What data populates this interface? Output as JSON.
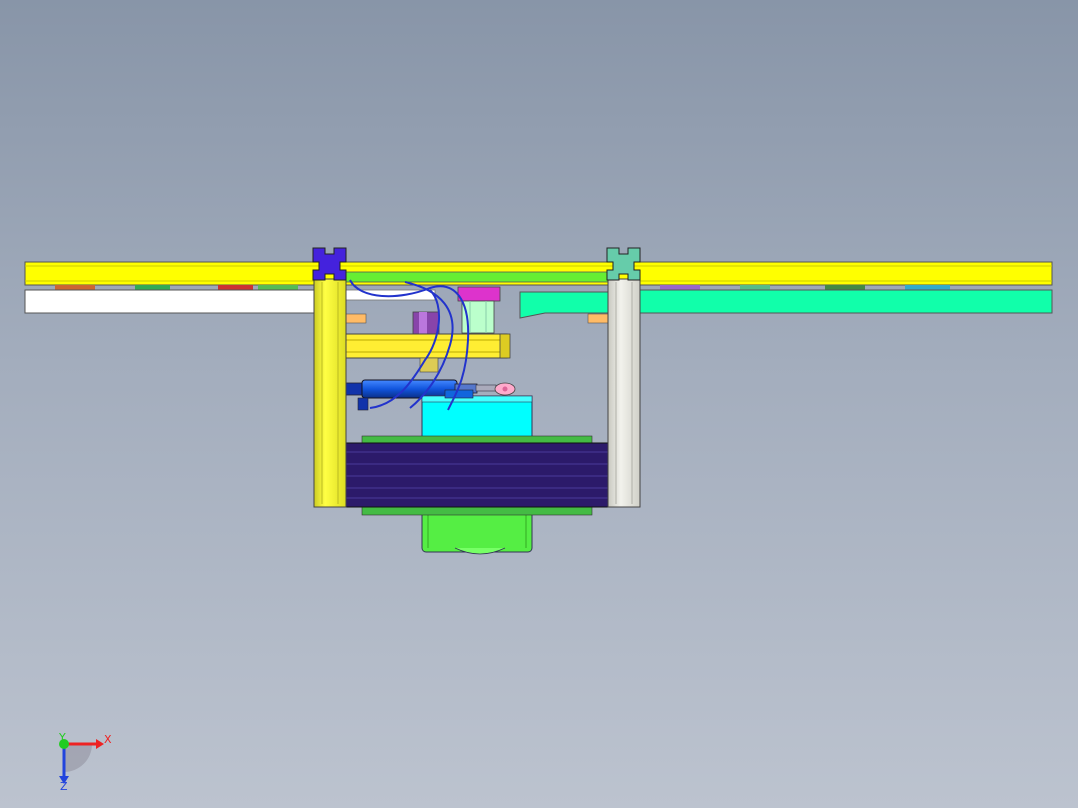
{
  "viewport": {
    "background_top": "#8895a8",
    "background_bottom": "#bcc3cf"
  },
  "colors": {
    "rail_yellow": "#ffff00",
    "profile_white": "#ffffff",
    "profile_teal": "#11ffaa",
    "post_yellow": "#ffff33",
    "post_grey": "#e8e8e0",
    "connector_purple": "#4422dd",
    "connector_teal": "#66ccaa",
    "motor_cyan": "#00ffff",
    "gearbox_green": "#55ee44",
    "belt_navy": "#2c1a6a",
    "cylinder_blue": "#1155dd",
    "hose_blue": "#2233cc",
    "bracket_yellow": "#ffee33",
    "magenta_part": "#dd33cc",
    "mint_part": "#bbffcc",
    "orange_pad": "#ffbb66",
    "outline": "#333333"
  },
  "triad": {
    "x_label": "X",
    "y_label": "Y",
    "z_label": "Z",
    "x_color": "#ee2222",
    "y_color": "#22cc22",
    "z_color": "#2244dd"
  }
}
